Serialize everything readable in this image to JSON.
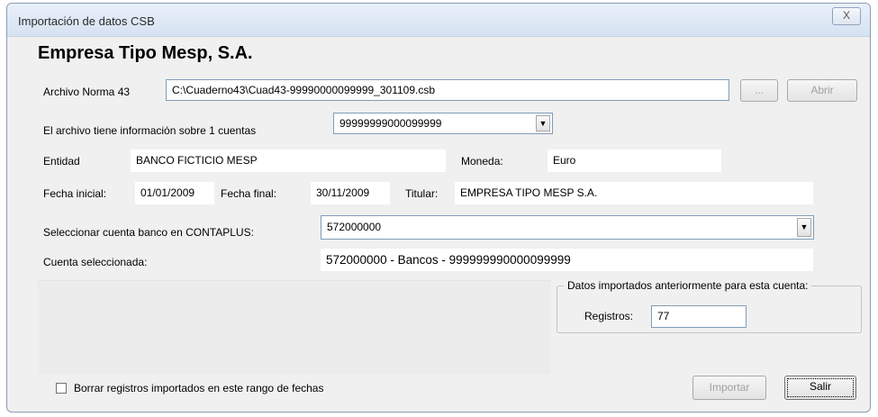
{
  "window": {
    "title": "Importación de datos CSB",
    "close_label": "X"
  },
  "company": "Empresa Tipo Mesp, S.A.",
  "archivo": {
    "label": "Archivo Norma 43",
    "value": "C:\\Cuaderno43\\Cuad43-99990000099999_301109.csb",
    "browse_label": "...",
    "open_label": "Abrir"
  },
  "cuentas": {
    "label": "El archivo tiene información sobre 1 cuentas",
    "selected": "99999999000099999"
  },
  "entidad": {
    "label": "Entidad",
    "value": "BANCO FICTICIO MESP"
  },
  "moneda": {
    "label": "Moneda:",
    "value": "Euro"
  },
  "fecha_inicial": {
    "label": "Fecha inicial:",
    "value": "01/01/2009"
  },
  "fecha_final": {
    "label": "Fecha final:",
    "value": "30/11/2009"
  },
  "titular": {
    "label": "Titular:",
    "value": "EMPRESA TIPO MESP S.A."
  },
  "cuenta_contaplus": {
    "label": "Seleccionar cuenta banco en CONTAPLUS:",
    "selected": "572000000"
  },
  "cuenta_seleccionada": {
    "label": "Cuenta seleccionada:",
    "value": "572000000 - Bancos - 999999990000099999"
  },
  "datos_importados": {
    "legend": "Datos importados anteriormente para esta cuenta:",
    "registros_label": "Registros:",
    "registros_value": "77"
  },
  "borrar_checkbox": {
    "label": "Borrar registros importados en este rango de fechas",
    "checked": false
  },
  "buttons": {
    "importar": "Importar",
    "salir": "Salir"
  }
}
